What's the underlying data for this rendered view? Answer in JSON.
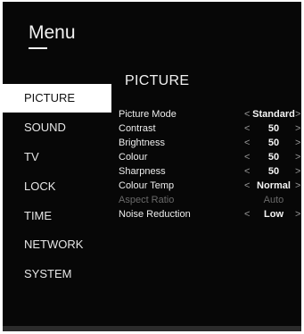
{
  "menu": {
    "title": "Menu"
  },
  "nav": {
    "items": [
      {
        "label": "PICTURE",
        "selected": true
      },
      {
        "label": "SOUND",
        "selected": false
      },
      {
        "label": "TV",
        "selected": false
      },
      {
        "label": "LOCK",
        "selected": false
      },
      {
        "label": "TIME",
        "selected": false
      },
      {
        "label": "NETWORK",
        "selected": false
      },
      {
        "label": "SYSTEM",
        "selected": false
      }
    ]
  },
  "section": {
    "title": "PICTURE"
  },
  "settings": [
    {
      "label": "Picture Mode",
      "value": "Standard",
      "left_arrow": "<",
      "right_arrow": ">",
      "enabled": true
    },
    {
      "label": "Contrast",
      "value": "50",
      "left_arrow": "<",
      "right_arrow": ">",
      "enabled": true
    },
    {
      "label": "Brightness",
      "value": "50",
      "left_arrow": "<",
      "right_arrow": ">",
      "enabled": true
    },
    {
      "label": "Colour",
      "value": "50",
      "left_arrow": "<",
      "right_arrow": ">",
      "enabled": true
    },
    {
      "label": "Sharpness",
      "value": "50",
      "left_arrow": "<",
      "right_arrow": ">",
      "enabled": true
    },
    {
      "label": "Colour Temp",
      "value": "Normal",
      "left_arrow": "<",
      "right_arrow": ">",
      "enabled": true
    },
    {
      "label": "Aspect Ratio",
      "value": "Auto",
      "left_arrow": "",
      "right_arrow": "",
      "enabled": false
    },
    {
      "label": "Noise Reduction",
      "value": "Low",
      "left_arrow": "<",
      "right_arrow": ">",
      "enabled": true
    }
  ],
  "colors": {
    "background": "#070707",
    "selected_bg": "#ffffff",
    "text": "#ededed",
    "disabled_text": "#6a6a6a"
  }
}
